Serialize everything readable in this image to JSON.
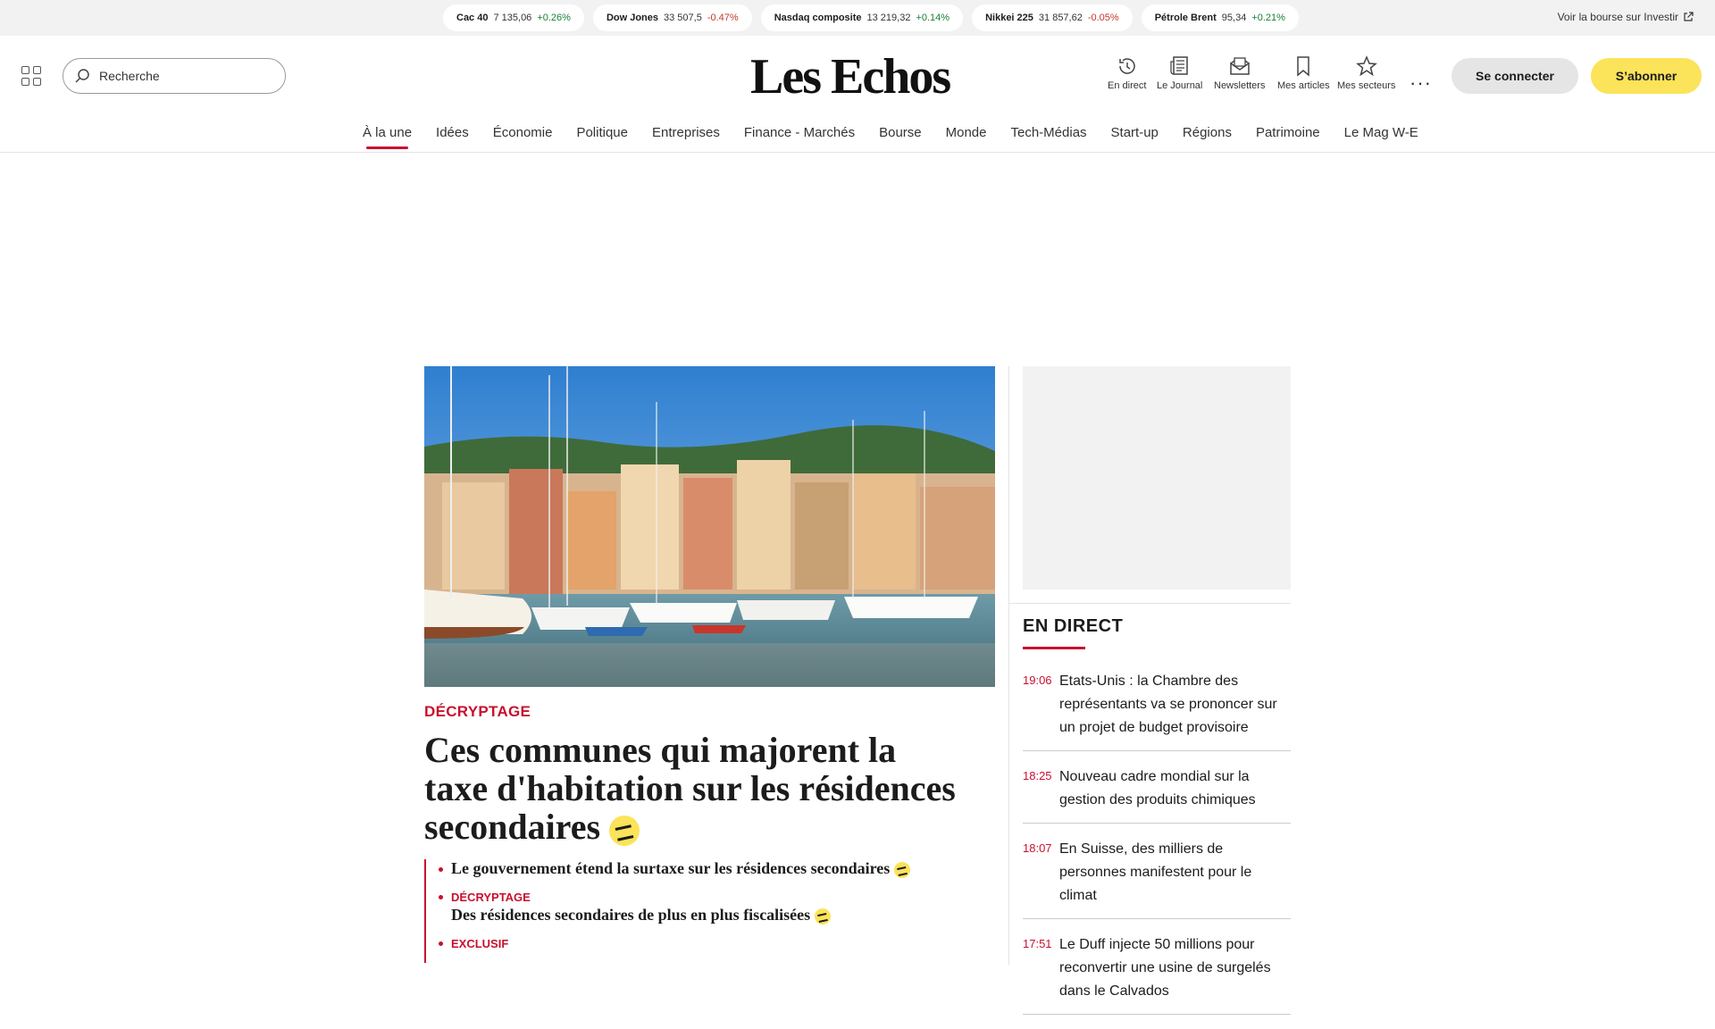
{
  "tickers": [
    {
      "name": "Cac 40",
      "value": "7 135,06",
      "change": "+0.26%",
      "direction": "up"
    },
    {
      "name": "Dow Jones",
      "value": "33 507,5",
      "change": "-0.47%",
      "direction": "down"
    },
    {
      "name": "Nasdaq composite",
      "value": "13 219,32",
      "change": "+0.14%",
      "direction": "up"
    },
    {
      "name": "Nikkei 225",
      "value": "31 857,62",
      "change": "-0.05%",
      "direction": "down"
    },
    {
      "name": "Pétrole Brent",
      "value": "95,34",
      "change": "+0.21%",
      "direction": "up"
    }
  ],
  "bourse_link": "Voir la bourse sur Investir",
  "header": {
    "search_placeholder": "Recherche",
    "logo": "Les Echos",
    "quick_links": [
      "En direct",
      "Le Journal",
      "Newsletters",
      "Mes articles",
      "Mes secteurs"
    ],
    "more": "···",
    "login": "Se connecter",
    "subscribe": "S’abonner"
  },
  "nav": [
    "À la une",
    "Idées",
    "Économie",
    "Politique",
    "Entreprises",
    "Finance - Marchés",
    "Bourse",
    "Monde",
    "Tech-Médias",
    "Start-up",
    "Régions",
    "Patrimoine",
    "Le Mag W-E"
  ],
  "hero": {
    "kicker": "DÉCRYPTAGE",
    "headline": "Ces communes qui majorent la taxe d'habitation sur les résidences secondaires",
    "related": [
      {
        "tag": "",
        "text": "Le gouvernement étend la surtaxe sur les résidences secondaires"
      },
      {
        "tag": "DÉCRYPTAGE",
        "text": "Des résidences secondaires de plus en plus fiscalisées"
      },
      {
        "tag": "EXCLUSIF",
        "text": ""
      }
    ]
  },
  "en_direct": {
    "title": "EN DIRECT",
    "items": [
      {
        "time": "19:06",
        "text": "Etats-Unis : la Chambre des représentants va se prononcer sur un projet de budget provisoire"
      },
      {
        "time": "18:25",
        "text": "Nouveau cadre mondial sur la gestion des produits chimiques"
      },
      {
        "time": "18:07",
        "text": "En Suisse, des milliers de personnes manifestent pour le climat"
      },
      {
        "time": "17:51",
        "text": "Le Duff injecte 50 millions pour reconvertir une usine de surgelés dans le Calvados"
      }
    ]
  },
  "colors": {
    "accent": "#c8102e",
    "subscribe": "#fbe35a",
    "up": "#1a7f37",
    "down": "#c0392b"
  }
}
